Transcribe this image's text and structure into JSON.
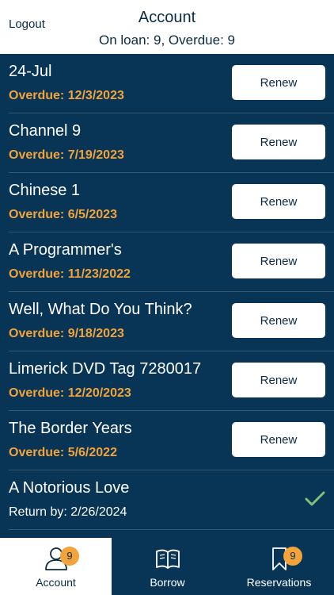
{
  "header": {
    "logout_label": "Logout",
    "title": "Account",
    "subtitle": "On loan: 9, Overdue: 9"
  },
  "loans": [
    {
      "title": "24-Jul",
      "status": "Overdue: 12/3/2023",
      "overdue": true,
      "action": "Renew"
    },
    {
      "title": "Channel 9",
      "status": "Overdue: 7/19/2023",
      "overdue": true,
      "action": "Renew"
    },
    {
      "title": "Chinese 1",
      "status": "Overdue: 6/5/2023",
      "overdue": true,
      "action": "Renew"
    },
    {
      "title": "A Programmer's",
      "status": "Overdue: 11/23/2022",
      "overdue": true,
      "action": "Renew"
    },
    {
      "title": "Well, What Do You Think?",
      "status": "Overdue: 9/18/2023",
      "overdue": true,
      "action": "Renew"
    },
    {
      "title": "Limerick DVD Tag 7280017",
      "status": "Overdue: 12/20/2023",
      "overdue": true,
      "action": "Renew"
    },
    {
      "title": "The Border Years",
      "status": "Overdue: 5/6/2022",
      "overdue": true,
      "action": "Renew"
    },
    {
      "title": "A Notorious Love",
      "status": "Return by: 2/26/2024",
      "overdue": false,
      "action": "",
      "icon": "check-icon"
    }
  ],
  "tabbar": {
    "tabs": [
      {
        "label": "Account",
        "icon": "person-icon",
        "badge": "9",
        "active": true
      },
      {
        "label": "Borrow",
        "icon": "book-icon",
        "badge": "",
        "active": false
      },
      {
        "label": "Reservations",
        "icon": "bookmark-icon",
        "badge": "9",
        "active": false
      }
    ]
  },
  "colors": {
    "navy": "#083456",
    "overdue": "#f2a33a",
    "check": "#7ec07a",
    "badge": "#f2a33a"
  }
}
